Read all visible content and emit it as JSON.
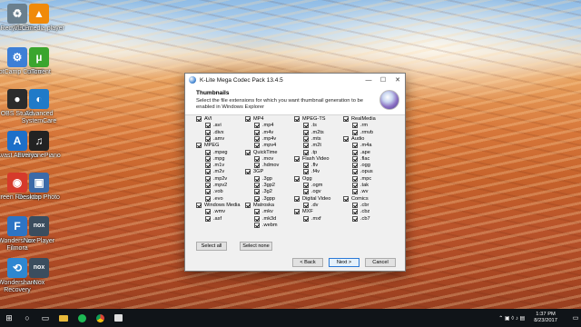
{
  "desktop_icons": [
    {
      "label": "Recycle Bin",
      "icon": "recycle-bin-icon",
      "color": "#6a7f8e",
      "glyph": "♻"
    },
    {
      "label": "VLC media player",
      "icon": "vlc-icon",
      "color": "#f08a0a",
      "glyph": "▲"
    },
    {
      "label": "BootCamp Control",
      "icon": "bootcamp-icon",
      "color": "#3d7fd6",
      "glyph": "⚙"
    },
    {
      "label": "uTorrent",
      "icon": "utorrent-icon",
      "color": "#3ba52e",
      "glyph": "µ"
    },
    {
      "label": "OBS Studio",
      "icon": "obs-icon",
      "color": "#2b2b2b",
      "glyph": "●"
    },
    {
      "label": "Advanced SystemCare",
      "icon": "systemcare-icon",
      "color": "#1f7ac8",
      "glyph": "◐"
    },
    {
      "label": "Avast Antivirus",
      "icon": "avast-icon",
      "color": "#1d6fc9",
      "glyph": "A"
    },
    {
      "label": "EveryonePiano",
      "icon": "piano-icon",
      "color": "#222222",
      "glyph": "♫"
    },
    {
      "label": "Screen Recorder",
      "icon": "screen-recorder-icon",
      "color": "#d63a2b",
      "glyph": "◉"
    },
    {
      "label": "Desktop Photo",
      "icon": "desktop-photo-icon",
      "color": "#3c6aa8",
      "glyph": "▣"
    },
    {
      "label": "Wondershare Filmora",
      "icon": "filmora-icon",
      "color": "#2d74c4",
      "glyph": "F"
    },
    {
      "label": "Nox Player",
      "icon": "nox-icon",
      "color": "#3b4d5e",
      "glyph": "nox"
    },
    {
      "label": "Wondershare Recovery",
      "icon": "recovery-icon",
      "color": "#2e87d1",
      "glyph": "⟲"
    },
    {
      "label": "Nox",
      "icon": "nox-icon",
      "color": "#3b4d5e",
      "glyph": "nox"
    }
  ],
  "dialog": {
    "title": "K-Lite Mega Codec Pack 13.4.5",
    "controls": {
      "minimize": "—",
      "maximize": "☐",
      "close": "✕"
    },
    "header_title": "Thumbnails",
    "header_desc": "Select the file extensions for which you want thumbnail generation to be enabled in Windows Explorer",
    "columns": [
      {
        "groups": [
          {
            "name": "AVI",
            "items": [
              ".avi",
              ".divx",
              ".amv"
            ]
          },
          {
            "name": "MPEG",
            "items": [
              ".mpeg",
              ".mpg",
              ".m1v",
              ".m2v",
              ".mp2v",
              ".mpv2",
              ".vob",
              ".evo"
            ]
          },
          {
            "name": "Windows Media",
            "items": [
              ".wmv",
              ".asf"
            ]
          }
        ]
      },
      {
        "groups": [
          {
            "name": "MP4",
            "items": [
              ".mp4",
              ".m4v",
              ".mp4v",
              ".mpv4"
            ]
          },
          {
            "name": "QuickTime",
            "items": [
              ".mov",
              ".hdmov"
            ]
          },
          {
            "name": "3GP",
            "items": [
              ".3gp",
              ".3gp2",
              ".3g2",
              ".3gpp"
            ]
          },
          {
            "name": "Matroska",
            "items": [
              ".mkv",
              ".mk3d",
              ".webm"
            ]
          }
        ]
      },
      {
        "groups": [
          {
            "name": "MPEG-TS",
            "items": [
              ".ts",
              ".m2ts",
              ".mts",
              ".m2t",
              ".tp"
            ]
          },
          {
            "name": "Flash Video",
            "items": [
              ".flv",
              ".f4v"
            ]
          },
          {
            "name": "Ogg",
            "items": [
              ".ogm",
              ".ogv"
            ]
          },
          {
            "name": "Digital Video",
            "items": [
              ".dv"
            ]
          },
          {
            "name": "MXF",
            "items": [
              ".mxf"
            ]
          }
        ]
      },
      {
        "groups": [
          {
            "name": "RealMedia",
            "items": [
              ".rm",
              ".rmvb"
            ]
          },
          {
            "name": "Audio",
            "items": [
              ".m4a",
              ".ape",
              ".flac",
              ".ogg",
              ".opus",
              ".mpc",
              ".tak",
              ".wv"
            ]
          },
          {
            "name": "Comics",
            "items": [
              ".cbr",
              ".cbz",
              ".cb7"
            ]
          }
        ]
      }
    ],
    "select_all": "Select all",
    "select_none": "Select none",
    "back": "< Back",
    "next": "Next >",
    "cancel": "Cancel"
  },
  "taskbar": {
    "start": "⊞",
    "search": "○",
    "task_view": "▭",
    "pinned": [
      "explorer-icon",
      "spotify-icon",
      "chrome-icon",
      "media-icon"
    ],
    "clock_time": "1:37 PM",
    "clock_date": "8/23/2017"
  }
}
